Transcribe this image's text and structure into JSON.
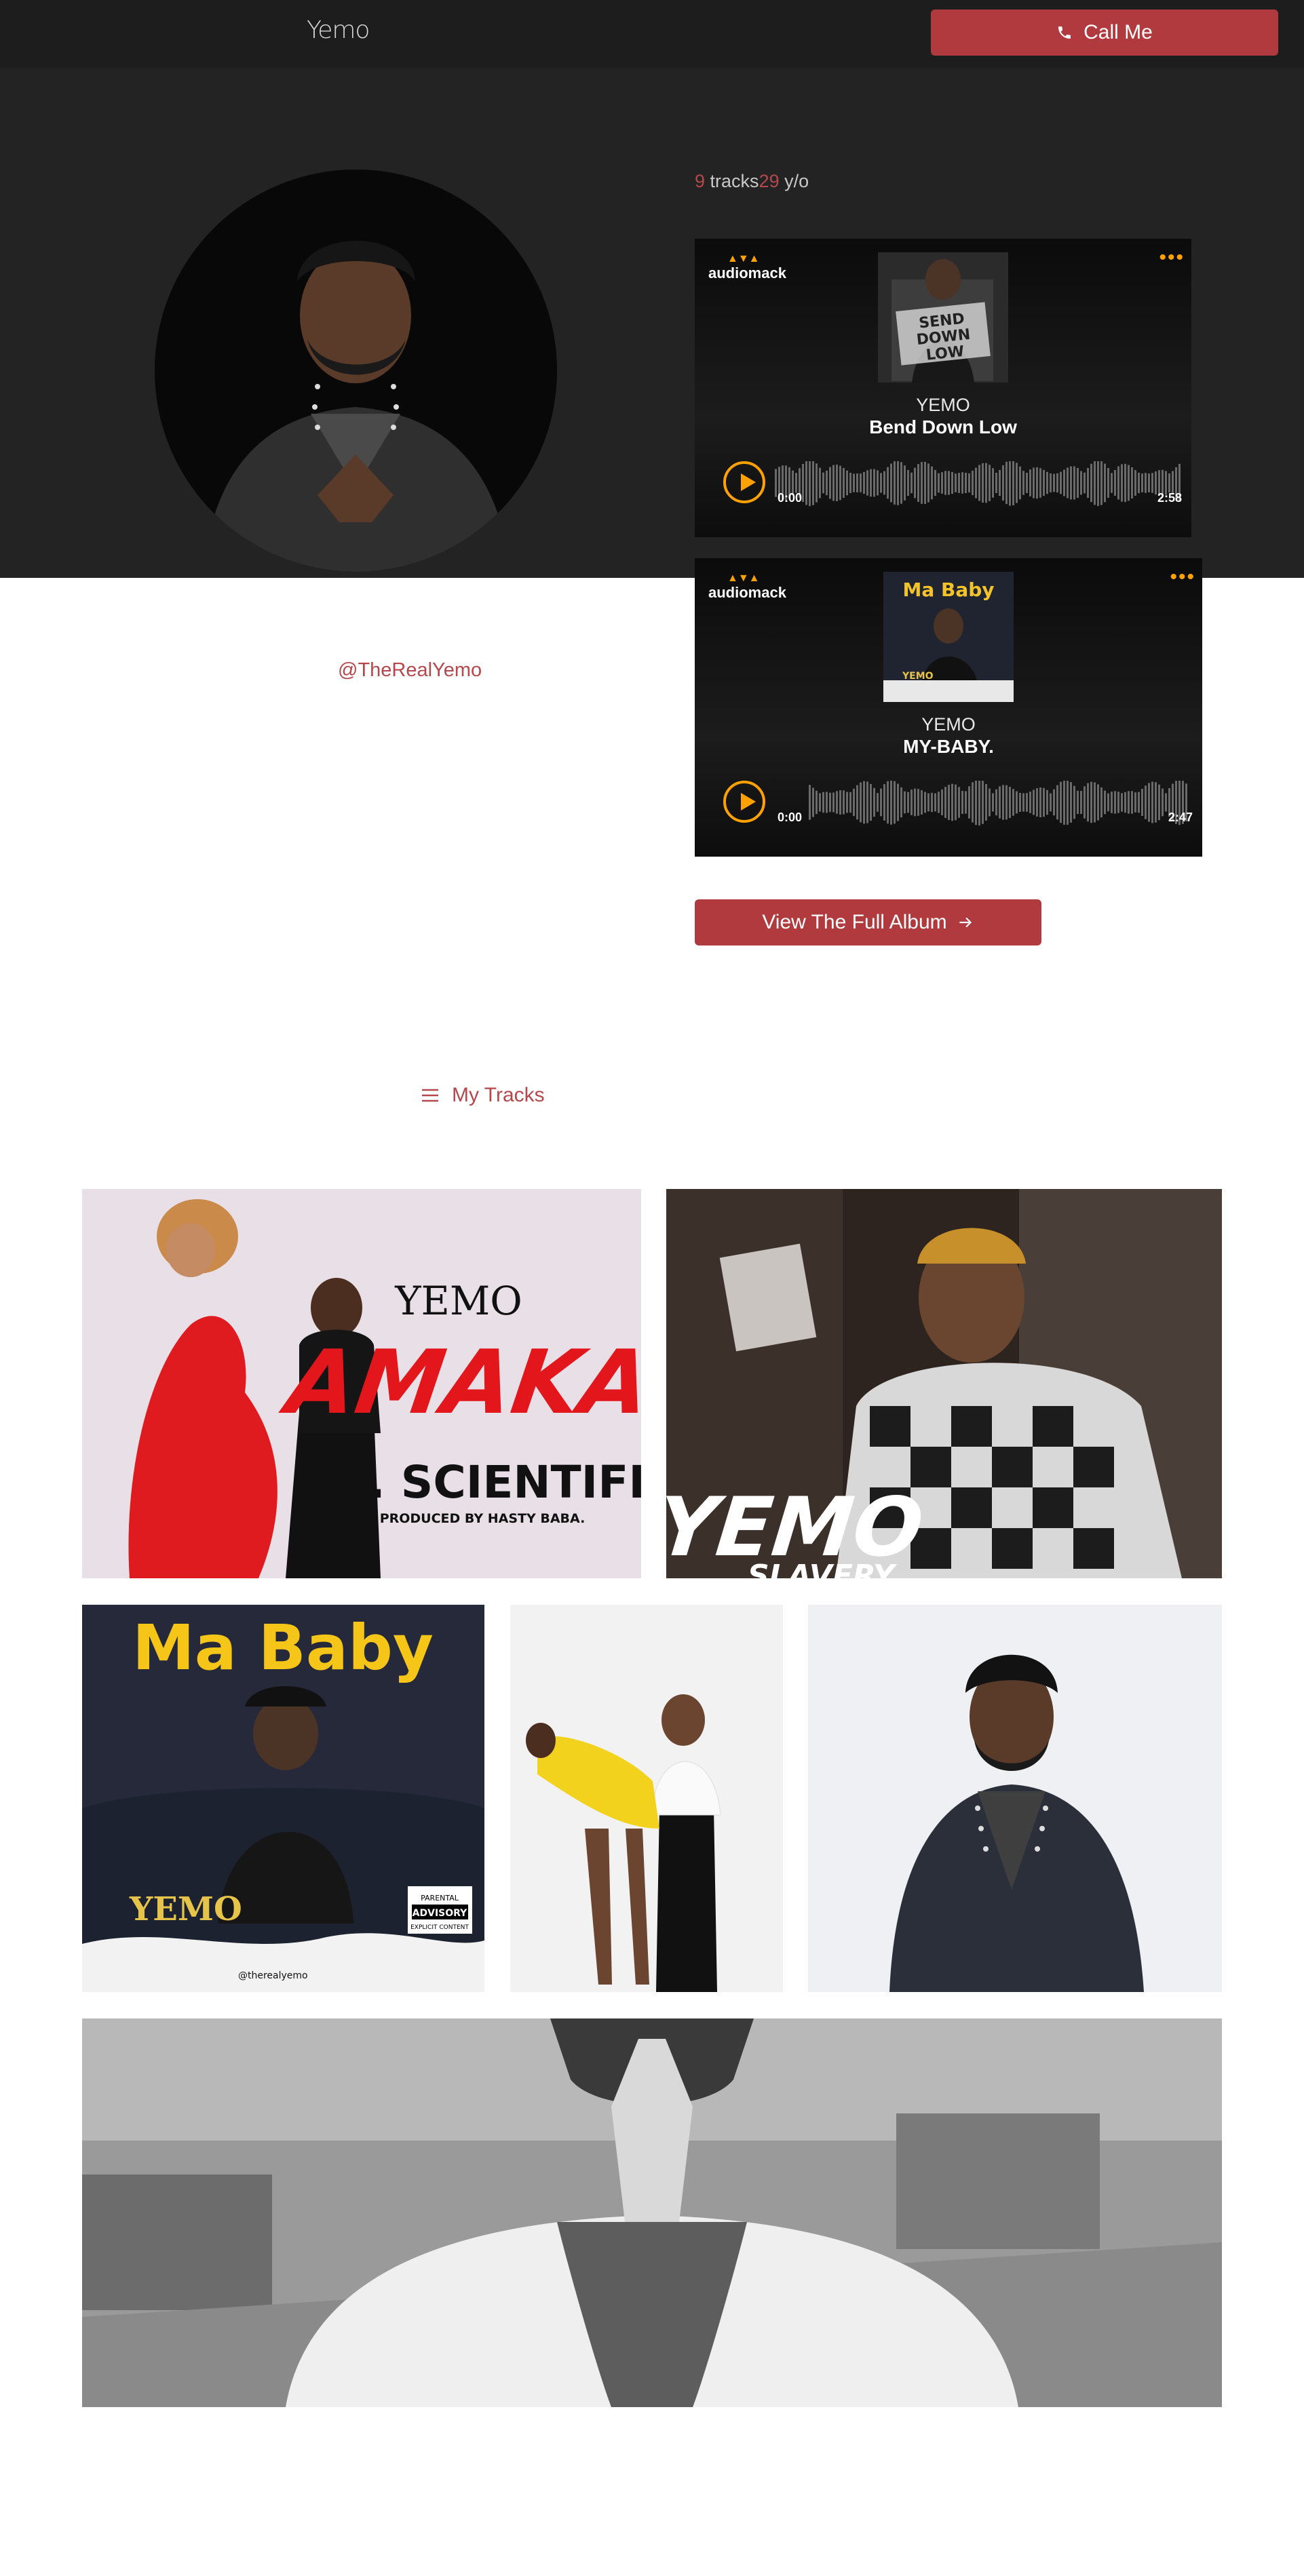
{
  "header": {
    "logo": "Yemo",
    "call_label": "Call Me"
  },
  "hero": {
    "tracks_count": "9",
    "tracks_label": " tracks",
    "age": "29",
    "age_label": " y/o",
    "handle": "@TheRealYemo"
  },
  "players": [
    {
      "brand": "audiomack",
      "artist": "YEMO",
      "title": "Bend Down Low",
      "time_current": "0:00",
      "time_total": "2:58",
      "cover_text": "BEND DOWN LOW"
    },
    {
      "brand": "audiomack",
      "artist": "YEMO",
      "title": "MY-BABY.",
      "time_current": "0:00",
      "time_total": "2:47",
      "cover_text": "Ma Baby"
    }
  ],
  "album_button": "View The Full Album",
  "tracks_link": "My Tracks",
  "gallery": {
    "amaka": {
      "artist": "YEMO",
      "title": "AMAKA",
      "feat": "FT. SCIENTIFIC",
      "credit": "PRODUCED BY HASTY BABA."
    },
    "slavery": {
      "artist": "YEMO",
      "title": "SLAVERY"
    },
    "mababy": {
      "title": "Ma Baby",
      "artist": "YEMO",
      "handle": "@therealyemo",
      "advisory": "PARENTAL ADVISORY EXPLICIT CONTENT"
    }
  },
  "colors": {
    "accent": "#b03a3e",
    "accent_text": "#b5484c",
    "header_bg": "#1d1d1d",
    "hero_bg": "#232323",
    "audiomack_orange": "#ffa200"
  }
}
